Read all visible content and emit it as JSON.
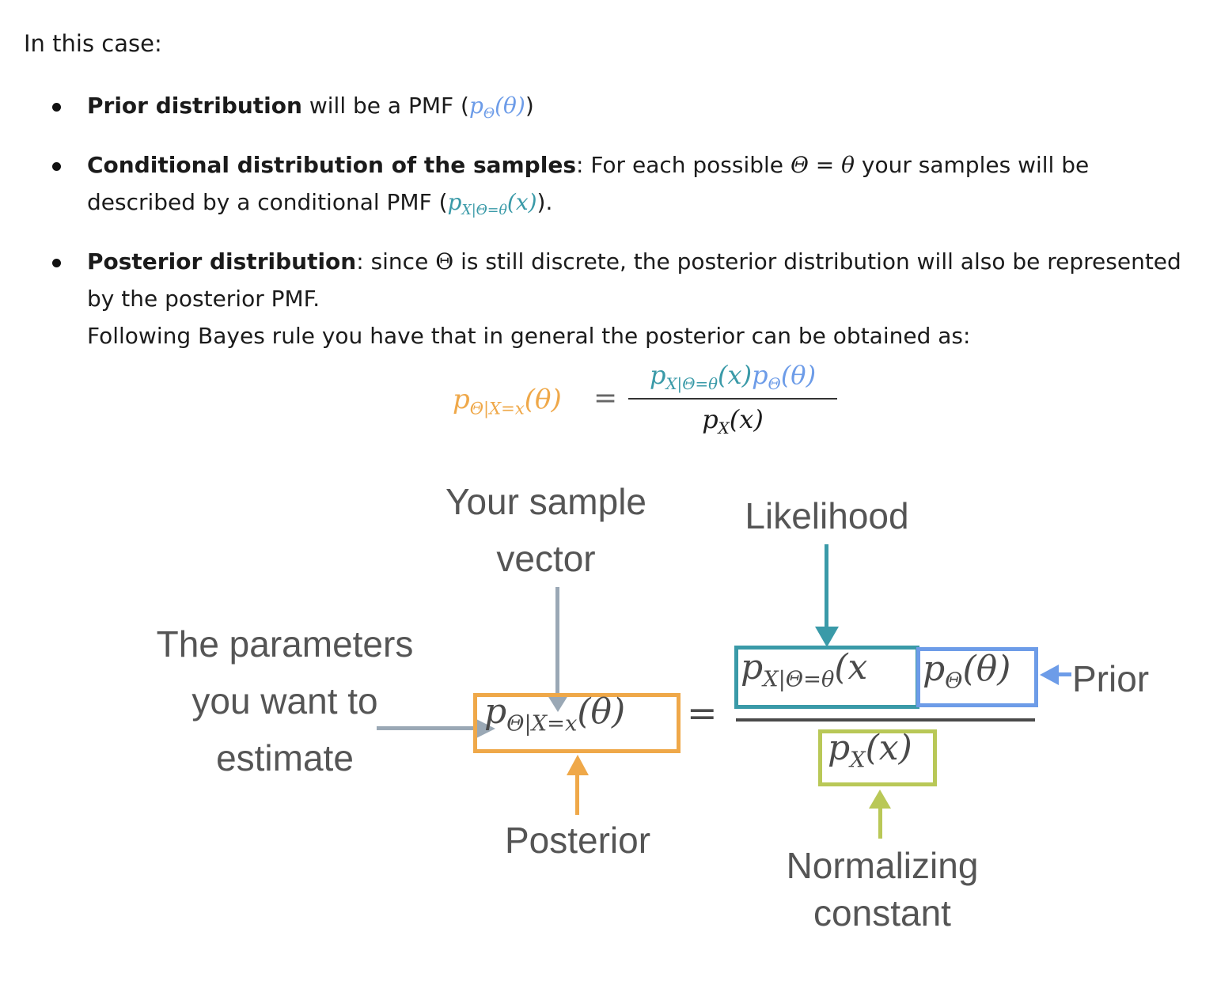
{
  "intro": "In this case:",
  "bullets": [
    {
      "bold": "Prior distribution",
      "text": " will be a PMF (",
      "math": "p",
      "math_sub": "Θ",
      "math_arg": "(θ)",
      "end": ")"
    },
    {
      "bold": "Conditional distribution of the samples",
      "text": ": For each possible ",
      "math": "Θ = θ",
      "text2": " your samples will be described by a conditional PMF (",
      "math2": "p",
      "math2_sub": "X|Θ=θ",
      "math2_arg": "(x)",
      "end": ")."
    },
    {
      "bold": "Posterior distribution",
      "text": ": since ",
      "math": "Θ",
      "text2": " is still discrete, the posterior distribution will also be represented by the posterior PMF.",
      "line2": "Following Bayes rule you have that in general the posterior can be obtained as:"
    }
  ],
  "formula": {
    "lhs_p": "p",
    "lhs_sub": "Θ|X=x",
    "lhs_arg": "(θ)",
    "eq": "=",
    "num_p1": "p",
    "num_sub1": "X|Θ=θ",
    "num_arg1": "(x)",
    "num_p2": "p",
    "num_sub2": "Θ",
    "num_arg2": "(θ)",
    "den_p": "p",
    "den_sub": "X",
    "den_arg": "(x)"
  },
  "diagram": {
    "label_sample": "Your sample vector",
    "label_likelihood": "Likelihood",
    "label_params_1": "The parameters",
    "label_params_2": "you want to",
    "label_params_3": "estimate",
    "label_posterior": "Posterior",
    "label_prior": "Prior",
    "label_norm_1": "Normalizing",
    "label_norm_2": "constant",
    "post_p": "p",
    "post_sub": "Θ|X=x",
    "post_arg": "(θ)",
    "lik_p": "p",
    "lik_sub": "X|Θ=θ",
    "lik_arg": "(x",
    "prior_p": "p",
    "prior_sub": "Θ",
    "prior_arg": "(θ)",
    "norm_p": "p",
    "norm_sub": "X",
    "norm_arg": "(x)",
    "eq": "="
  },
  "colors": {
    "prior": "#6d9ce8",
    "likelihood": "#3a9aa8",
    "posterior": "#efa849",
    "normalizing": "#b9c857",
    "sample_arrow": "#9aa8b5"
  }
}
